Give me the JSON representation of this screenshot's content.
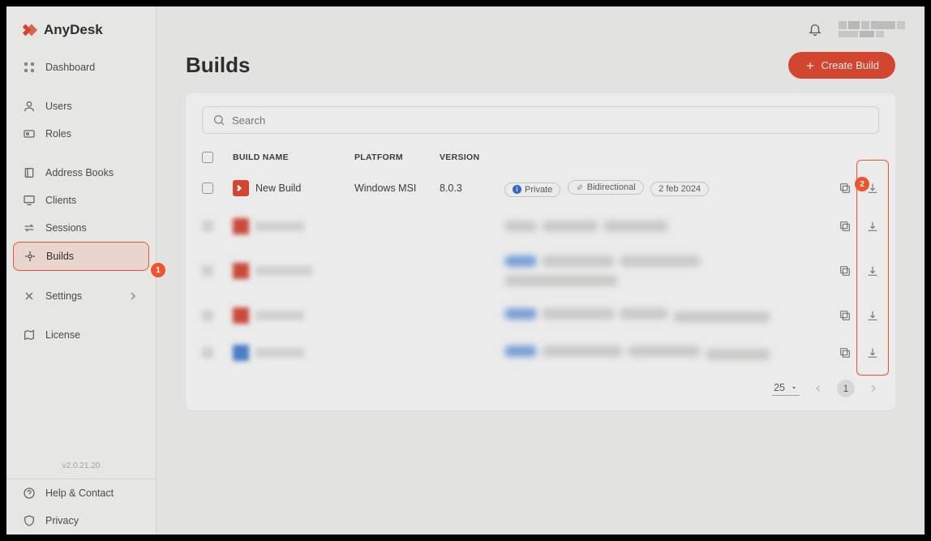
{
  "brand": "AnyDesk",
  "version": "v2.0.21.20",
  "sidebar": {
    "items": [
      {
        "label": "Dashboard",
        "icon": "grid"
      },
      {
        "label": "Users",
        "icon": "user"
      },
      {
        "label": "Roles",
        "icon": "id"
      },
      {
        "label": "Address Books",
        "icon": "book"
      },
      {
        "label": "Clients",
        "icon": "monitor"
      },
      {
        "label": "Sessions",
        "icon": "swap"
      },
      {
        "label": "Builds",
        "icon": "target",
        "selected": true
      },
      {
        "label": "Settings",
        "icon": "tools",
        "chevron": true
      },
      {
        "label": "License",
        "icon": "map"
      }
    ],
    "bottom": [
      {
        "label": "Help & Contact",
        "icon": "help"
      },
      {
        "label": "Privacy",
        "icon": "shield"
      }
    ]
  },
  "page": {
    "title": "Builds",
    "create_label": "Create Build"
  },
  "search": {
    "placeholder": "Search"
  },
  "table": {
    "headers": {
      "name": "BUILD NAME",
      "platform": "PLATFORM",
      "version": "VERSION"
    },
    "rows": [
      {
        "name": "New Build",
        "platform": "Windows MSI",
        "version": "8.0.3",
        "tags": [
          "Private",
          "Bidirectional",
          "2 feb 2024"
        ]
      }
    ]
  },
  "pagination": {
    "size": "25",
    "page": "1"
  },
  "annotations": {
    "step1": "1",
    "step2": "2"
  }
}
